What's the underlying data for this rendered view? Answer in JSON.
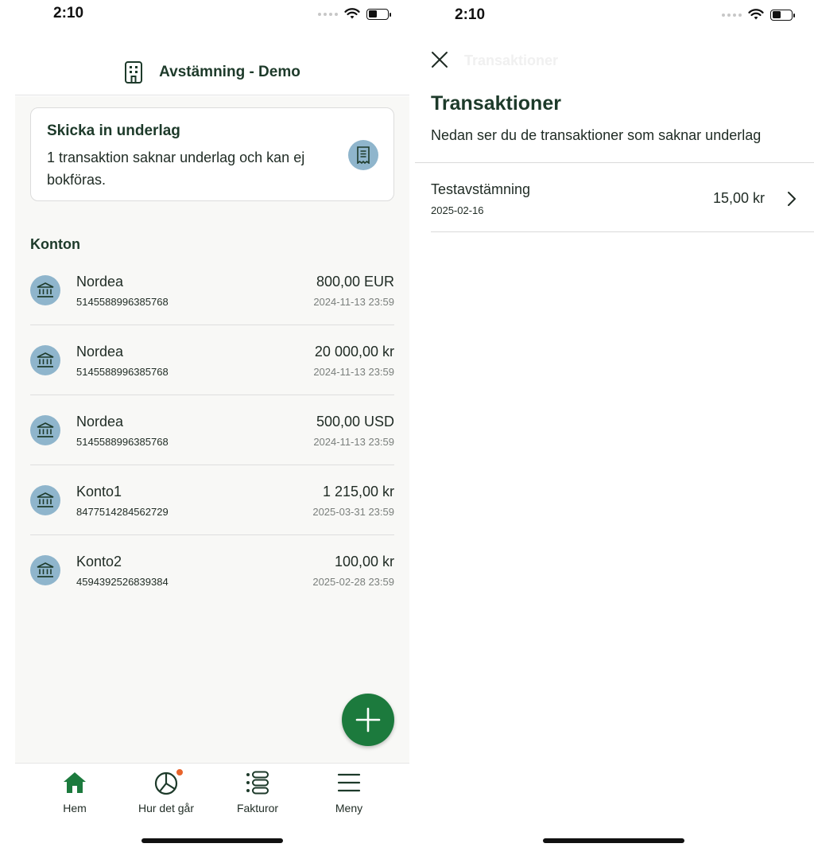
{
  "left": {
    "status": {
      "time": "2:10"
    },
    "header": {
      "title": "Avstämning - Demo",
      "icon": "building-icon"
    },
    "notice": {
      "title": "Skicka in underlag",
      "text": "1 transaktion saknar underlag och kan ej bokföras.",
      "icon": "receipt-icon"
    },
    "accounts_title": "Konton",
    "accounts": [
      {
        "name": "Nordea",
        "number": "5145588996385768",
        "amount": "800,00 EUR",
        "date": "2024-11-13 23:59"
      },
      {
        "name": "Nordea",
        "number": "5145588996385768",
        "amount": "20 000,00 kr",
        "date": "2024-11-13 23:59"
      },
      {
        "name": "Nordea",
        "number": "5145588996385768",
        "amount": "500,00 USD",
        "date": "2024-11-13 23:59"
      },
      {
        "name": "Konto1",
        "number": "8477514284562729",
        "amount": "1 215,00 kr",
        "date": "2025-03-31 23:59"
      },
      {
        "name": "Konto2",
        "number": "4594392526839384",
        "amount": "100,00 kr",
        "date": "2025-02-28 23:59"
      }
    ],
    "tabs": [
      {
        "label": "Hem",
        "icon": "home-icon"
      },
      {
        "label": "Hur det går",
        "icon": "pie-chart-icon"
      },
      {
        "label": "Fakturor",
        "icon": "list-icon"
      },
      {
        "label": "Meny",
        "icon": "hamburger-icon"
      }
    ],
    "colors": {
      "primary": "#1c7a3d",
      "accent_icon_bg": "#8fb5cc",
      "badge": "#e8632b",
      "heading": "#1d3a2a"
    }
  },
  "right": {
    "status": {
      "time": "2:10"
    },
    "nav_ghost_title": "Transaktioner",
    "title": "Transaktioner",
    "subtitle": "Nedan ser du de transaktioner som saknar underlag",
    "transactions": [
      {
        "name": "Testavstämning",
        "date": "2025-02-16",
        "amount": "15,00 kr"
      }
    ]
  }
}
